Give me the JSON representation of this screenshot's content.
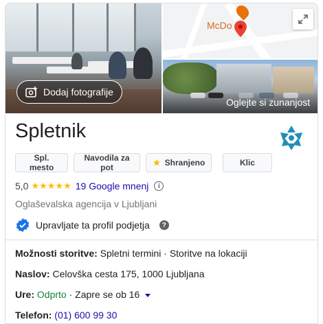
{
  "photos": {
    "add_photos_label": "Dodaj fotografije",
    "exterior_label": "Oglejte si zunanjost",
    "map_poi_label": "McDo  d's"
  },
  "business": {
    "name": "Spletnik",
    "rating_value": "5,0",
    "stars": "★★★★★",
    "reviews_label": "19 Google mnenj",
    "category": "Oglaševalska agencija v Ljubljani",
    "manage_label": "Upravljate ta profil podjetja"
  },
  "actions": [
    {
      "label": "Spl. mesto"
    },
    {
      "label": "Navodila za pot"
    },
    {
      "label": "Shranjeno"
    },
    {
      "label": "Klic"
    }
  ],
  "details": {
    "services_label": "Možnosti storitve:",
    "services_value": "Spletni termini · Storitve na lokaciji",
    "address_label": "Naslov:",
    "address_value": "Celovška cesta 175, 1000 Ljubljana",
    "hours_label": "Ure:",
    "hours_status": "Odprto",
    "hours_value": "· Zapre se ob 16",
    "phone_label": "Telefon:",
    "phone_value": "(01) 600 99 30"
  },
  "colors": {
    "link": "#1a0dab",
    "open": "#188038",
    "star": "#fbbc04",
    "verified": "#1a73e8",
    "logo": "#1f8fb8"
  }
}
